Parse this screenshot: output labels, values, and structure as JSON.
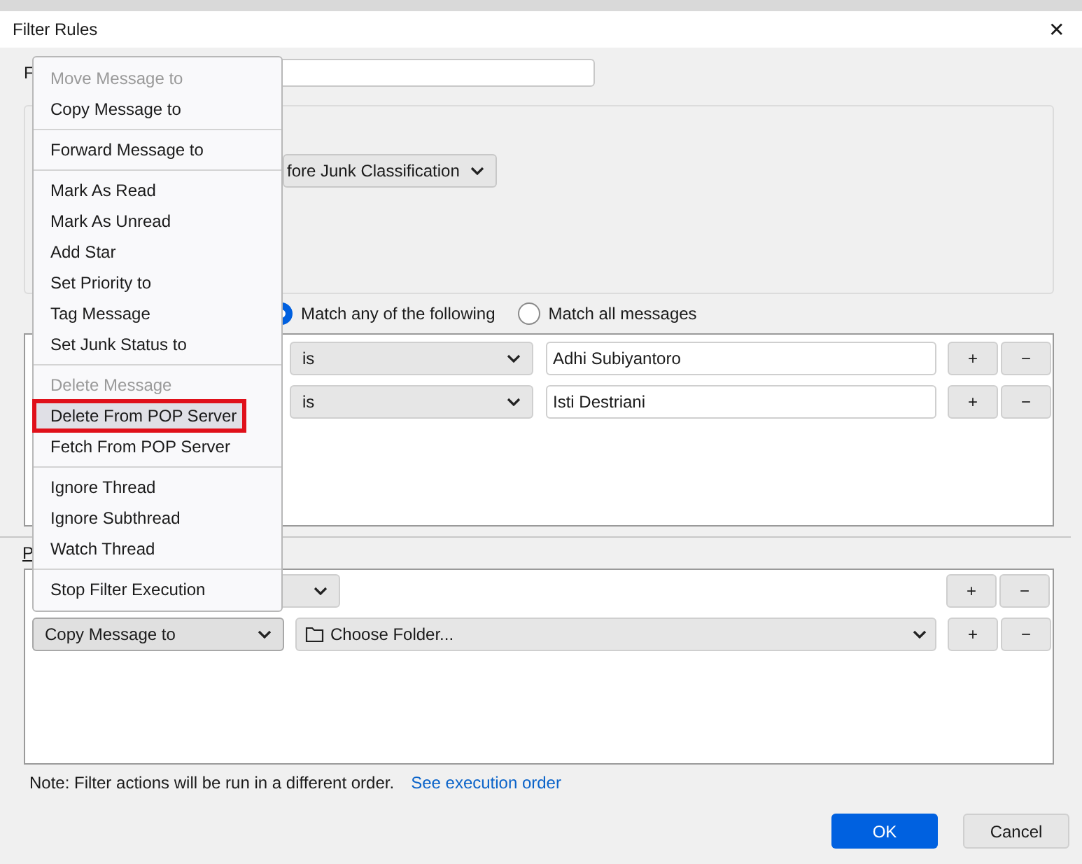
{
  "window": {
    "title": "Filter Rules",
    "close": "✕"
  },
  "filter_name": {
    "label": "F"
  },
  "run_dropdown": {
    "value": "fore Junk Classification"
  },
  "match_options": [
    {
      "label": "Match any of the following",
      "selected": true
    },
    {
      "label": "Match all messages",
      "selected": false
    }
  ],
  "conditions": [
    {
      "operator": "is",
      "value": "Adhi Subiyantoro",
      "add": "+",
      "remove": "−"
    },
    {
      "operator": "is",
      "value": "Isti Destriani",
      "add": "+",
      "remove": "−"
    }
  ],
  "actions_label": "P",
  "actions": [
    {
      "kind": "blank",
      "add": "+",
      "remove": "−"
    },
    {
      "kind": "folder",
      "action": "Copy Message to",
      "target": "Choose Folder...",
      "add": "+",
      "remove": "−"
    }
  ],
  "note": {
    "text": "Note: Filter actions will be run in a different order.",
    "link": "See execution order"
  },
  "buttons": [
    {
      "label": "OK",
      "primary": true
    },
    {
      "label": "Cancel",
      "primary": false
    }
  ],
  "menu": {
    "groups": [
      [
        {
          "label": "Move Message to",
          "disabled": true,
          "selected": false,
          "annotated": false
        },
        {
          "label": "Copy Message to",
          "disabled": false,
          "selected": false,
          "annotated": false
        }
      ],
      [
        {
          "label": "Forward Message to",
          "disabled": false,
          "selected": false,
          "annotated": false
        }
      ],
      [
        {
          "label": "Mark As Read",
          "disabled": false,
          "selected": false,
          "annotated": false
        },
        {
          "label": "Mark As Unread",
          "disabled": false,
          "selected": false,
          "annotated": false
        },
        {
          "label": "Add Star",
          "disabled": false,
          "selected": false,
          "annotated": false
        },
        {
          "label": "Set Priority to",
          "disabled": false,
          "selected": false,
          "annotated": false
        },
        {
          "label": "Tag Message",
          "disabled": false,
          "selected": false,
          "annotated": false
        },
        {
          "label": "Set Junk Status to",
          "disabled": false,
          "selected": false,
          "annotated": false
        }
      ],
      [
        {
          "label": "Delete Message",
          "disabled": true,
          "selected": false,
          "annotated": false
        },
        {
          "label": "Delete From POP Server",
          "disabled": false,
          "selected": true,
          "annotated": true
        },
        {
          "label": "Fetch From POP Server",
          "disabled": false,
          "selected": false,
          "annotated": false
        }
      ],
      [
        {
          "label": "Ignore Thread",
          "disabled": false,
          "selected": false,
          "annotated": false
        },
        {
          "label": "Ignore Subthread",
          "disabled": false,
          "selected": false,
          "annotated": false
        },
        {
          "label": "Watch Thread",
          "disabled": false,
          "selected": false,
          "annotated": false
        }
      ],
      [
        {
          "label": "Stop Filter Execution",
          "disabled": false,
          "selected": false,
          "annotated": false
        }
      ]
    ]
  }
}
